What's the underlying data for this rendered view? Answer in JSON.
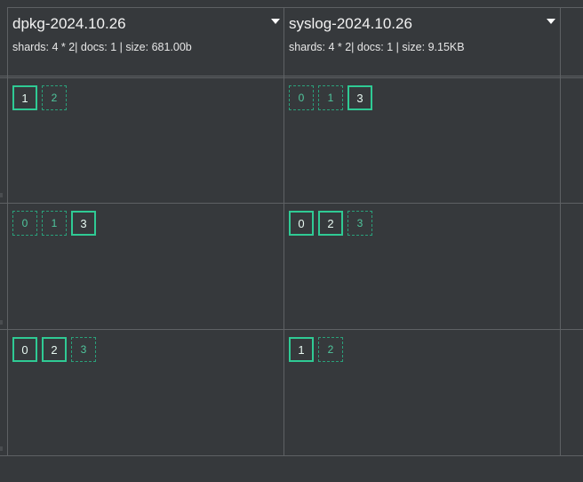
{
  "indices": [
    {
      "name": "dpkg-2024.10.26",
      "stats": "shards: 4 * 2| docs: 1 | size: 681.00b",
      "nodes": [
        [
          {
            "id": "1",
            "type": "primary"
          },
          {
            "id": "2",
            "type": "replica"
          }
        ],
        [
          {
            "id": "0",
            "type": "replica"
          },
          {
            "id": "1",
            "type": "replica"
          },
          {
            "id": "3",
            "type": "primary"
          }
        ],
        [
          {
            "id": "0",
            "type": "primary"
          },
          {
            "id": "2",
            "type": "primary"
          },
          {
            "id": "3",
            "type": "replica"
          }
        ]
      ]
    },
    {
      "name": "syslog-2024.10.26",
      "stats": "shards: 4 * 2| docs: 1 | size: 9.15KB",
      "nodes": [
        [
          {
            "id": "0",
            "type": "replica"
          },
          {
            "id": "1",
            "type": "replica"
          },
          {
            "id": "3",
            "type": "primary"
          }
        ],
        [
          {
            "id": "0",
            "type": "primary"
          },
          {
            "id": "2",
            "type": "primary"
          },
          {
            "id": "3",
            "type": "replica"
          }
        ],
        [
          {
            "id": "1",
            "type": "primary"
          },
          {
            "id": "2",
            "type": "replica"
          }
        ]
      ]
    }
  ],
  "colors": {
    "background": "#36393c",
    "grid_line": "#5e6164",
    "shard_primary": "#2fca94",
    "shard_replica": "#2aa07a"
  }
}
